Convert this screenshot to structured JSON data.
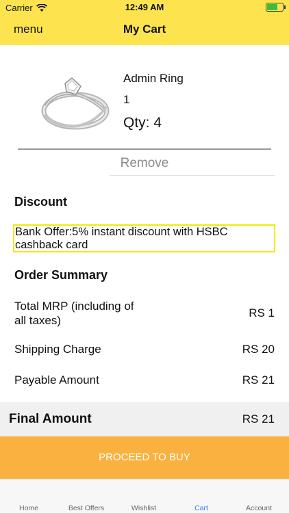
{
  "status_bar": {
    "carrier": "Carrier",
    "time": "12:49 AM"
  },
  "nav": {
    "menu_label": "menu",
    "title": "My Cart"
  },
  "cart_item": {
    "name": "Admin Ring",
    "price": "1",
    "quantity": "Qty: 4",
    "remove_label": "Remove"
  },
  "discount": {
    "title": "Discount",
    "offer_text": "Bank Offer:5% instant discount with HSBC cashback card"
  },
  "order_summary": {
    "title": "Order Summary",
    "rows": [
      {
        "label": "Total MRP (including of all taxes)",
        "value": "RS 1"
      },
      {
        "label": "Shipping Charge",
        "value": "RS 20"
      },
      {
        "label": "Payable Amount",
        "value": "RS 21"
      }
    ]
  },
  "final": {
    "label": "Final Amount",
    "value": "RS 21"
  },
  "proceed_label": "PROCEED TO BUY",
  "tabs": [
    {
      "label": "Home",
      "active": false
    },
    {
      "label": "Best Offers",
      "active": false
    },
    {
      "label": "Wishlist",
      "active": false
    },
    {
      "label": "Cart",
      "active": true
    },
    {
      "label": "Account",
      "active": false
    }
  ],
  "colors": {
    "header": "#fde44e",
    "accent": "#fbb13f",
    "offer_border": "#f5e700",
    "active_tab": "#2f7bf0"
  }
}
